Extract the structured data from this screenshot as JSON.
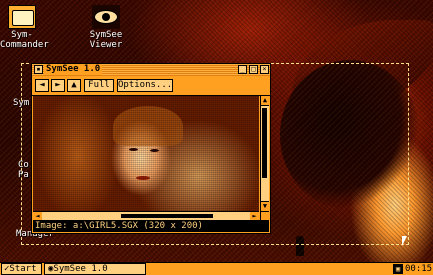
{
  "desktop": {
    "icons": [
      {
        "label_line1": "Sym-",
        "label_line2": "Commander"
      },
      {
        "label_line1": "SymSee",
        "label_line2": "Viewer"
      }
    ],
    "side_labels": [
      "Sym",
      "Co",
      "Pa",
      "Manager"
    ]
  },
  "window": {
    "title": "SymSee 1.0",
    "toolbar": {
      "back_glyph": "◄",
      "forward_glyph": "►",
      "up_glyph": "▲",
      "full_label": "Full",
      "options_label": "Options..."
    },
    "status": "Image: a:\\GIRL5.SGX (320 x 200)"
  },
  "taskbar": {
    "start_label": "Start",
    "task_label": "SymSee 1.0",
    "clock": "00:15"
  },
  "icons": {
    "commander": "folder-eye-icon",
    "viewer": "eye-icon"
  },
  "colors": {
    "window_bg": "#ffa020",
    "panel_light": "#ffd080",
    "status_bg": "#000000"
  }
}
